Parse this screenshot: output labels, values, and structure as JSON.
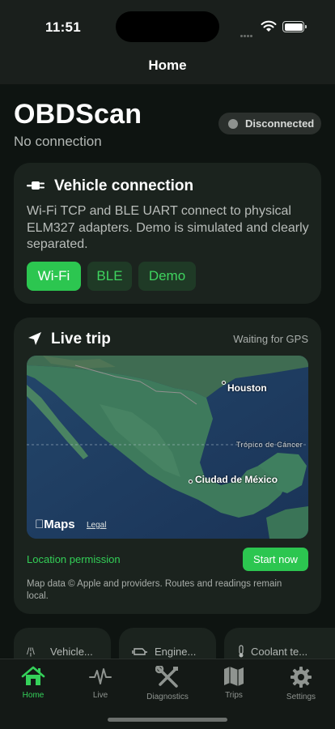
{
  "status_bar": {
    "time": "11:51"
  },
  "nav": {
    "title": "Home"
  },
  "header": {
    "app_title": "OBDScan",
    "subtitle": "No connection",
    "connection_status": "Disconnected"
  },
  "vehicle_card": {
    "title": "Vehicle connection",
    "description": "Wi-Fi TCP and BLE UART connect to physical ELM327 adapters. Demo is simulated and clearly separated.",
    "buttons": {
      "wifi": "Wi-Fi",
      "ble": "BLE",
      "demo": "Demo"
    }
  },
  "trip_card": {
    "title": "Live trip",
    "gps_status": "Waiting for GPS",
    "map": {
      "labels": {
        "houston": "Houston",
        "mexico_city": "Ciudad de México",
        "tropic": "Trópico de Cáncer"
      },
      "logo": "Maps",
      "legal": "Legal"
    },
    "location_permission": "Location permission",
    "start_button": "Start now",
    "credit": "Map data © Apple and providers. Routes and readings remain local."
  },
  "gauges": [
    {
      "icon": "speed-icon",
      "label": "Vehicle..."
    },
    {
      "icon": "engine-icon",
      "label": "Engine..."
    },
    {
      "icon": "thermometer-icon",
      "label": "Coolant te..."
    }
  ],
  "tabs": [
    {
      "label": "Home",
      "icon": "home-icon",
      "active": true
    },
    {
      "label": "Live",
      "icon": "waveform-icon",
      "active": false
    },
    {
      "label": "Diagnostics",
      "icon": "wrench-screwdriver-icon",
      "active": false
    },
    {
      "label": "Trips",
      "icon": "map-icon",
      "active": false
    },
    {
      "label": "Settings",
      "icon": "gear-icon",
      "active": false
    }
  ],
  "colors": {
    "accent": "#2cc650",
    "background": "#0e1411",
    "card": "#1b231e"
  }
}
